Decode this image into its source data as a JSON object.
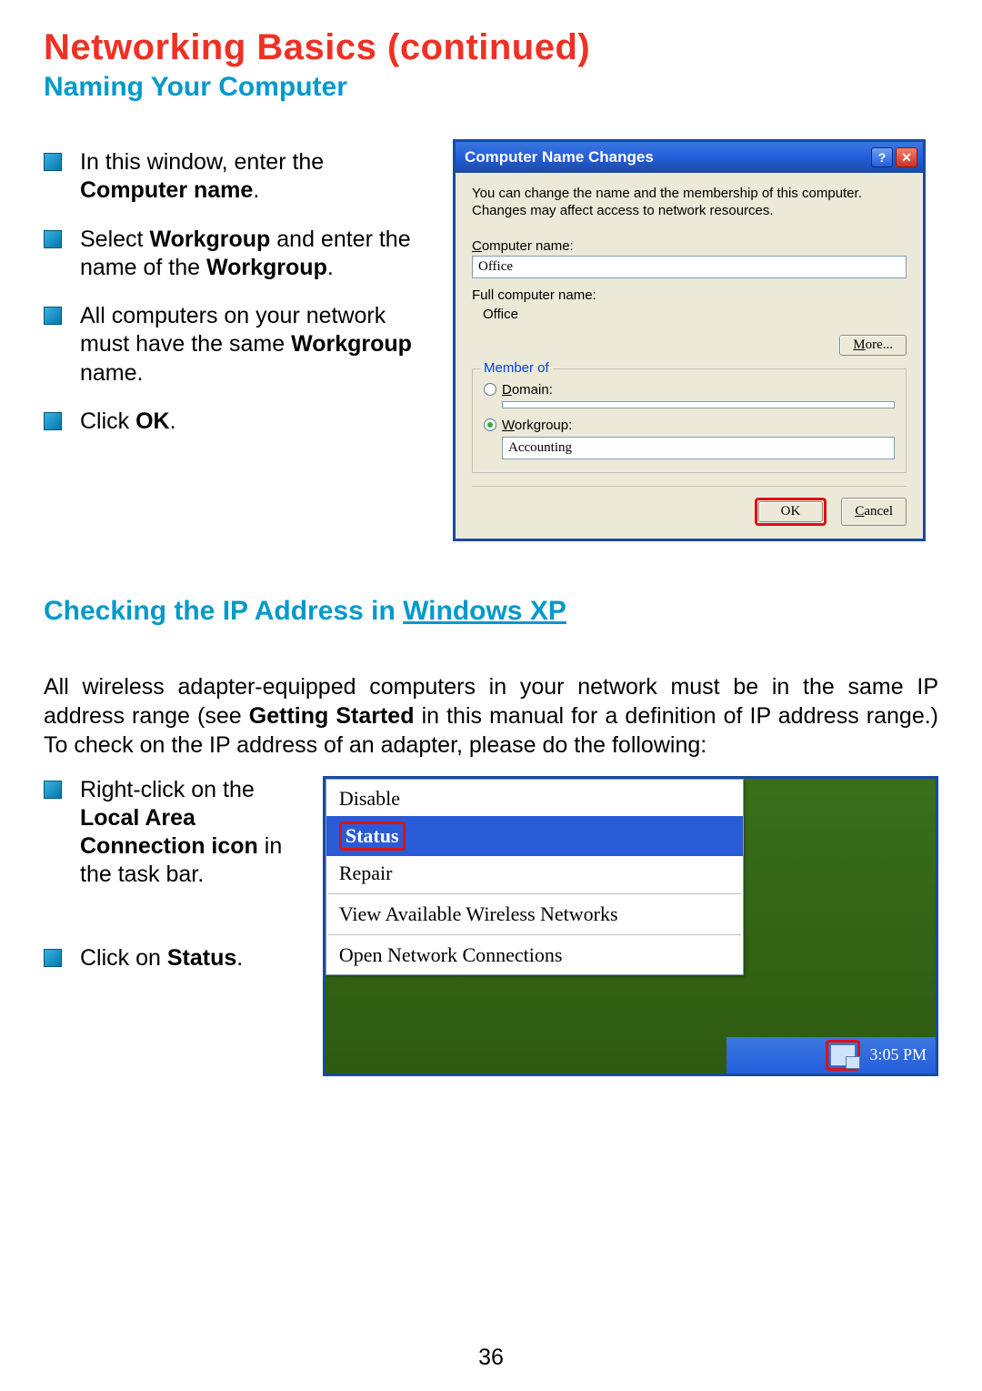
{
  "page": {
    "title": "Networking Basics (continued)",
    "subtitle": "Naming Your Computer",
    "number": "36"
  },
  "section1": {
    "bullets": {
      "b1_pre": "In this window, enter the ",
      "b1_bold": "Computer name",
      "b1_post": ".",
      "b2_pre": "Select ",
      "b2_bold1": "Workgroup",
      "b2_mid": " and enter the name of the ",
      "b2_bold2": "Workgroup",
      "b2_post": ".",
      "b3_pre": "All computers on your network must have the same ",
      "b3_bold": "Workgroup",
      "b3_post": " name.",
      "b4_pre": "Click ",
      "b4_bold": "OK",
      "b4_post": "."
    }
  },
  "dialog": {
    "title": "Computer Name Changes",
    "desc": "You can change the name and the membership of this computer. Changes may affect access to network resources.",
    "computer_name_label_pre": "C",
    "computer_name_label_post": "omputer name:",
    "computer_name_value": "Office",
    "full_label": "Full computer name:",
    "full_value": "Office",
    "more_btn_pre": "M",
    "more_btn_post": "ore...",
    "member_of": "Member of",
    "domain_pre": "D",
    "domain_post": "omain:",
    "domain_value": "",
    "workgroup_pre": "W",
    "workgroup_post": "orkgroup:",
    "workgroup_value": "Accounting",
    "ok": "OK",
    "cancel_pre": "C",
    "cancel_post": "ancel"
  },
  "section2": {
    "heading_pre": "Checking the IP Address in ",
    "heading_under": "Windows XP",
    "para_pre": "All wireless adapter-equipped computers in your network must be in the same IP address range (see ",
    "para_bold": "Getting Started",
    "para_post": " in this manual for a definition of IP address range.) To check on the IP address of an adapter, please do the following:",
    "bullets": {
      "b1_pre": "Right-click on the ",
      "b1_bold": "Local Area Connection icon",
      "b1_post": " in the task bar.",
      "b2_pre": "Click on ",
      "b2_bold": "Status",
      "b2_post": "."
    }
  },
  "context_menu": {
    "disable": "Disable",
    "status": "Status",
    "repair": "Repair",
    "view": "View Available Wireless Networks",
    "open": "Open Network Connections"
  },
  "taskbar": {
    "clock": "3:05 PM"
  }
}
